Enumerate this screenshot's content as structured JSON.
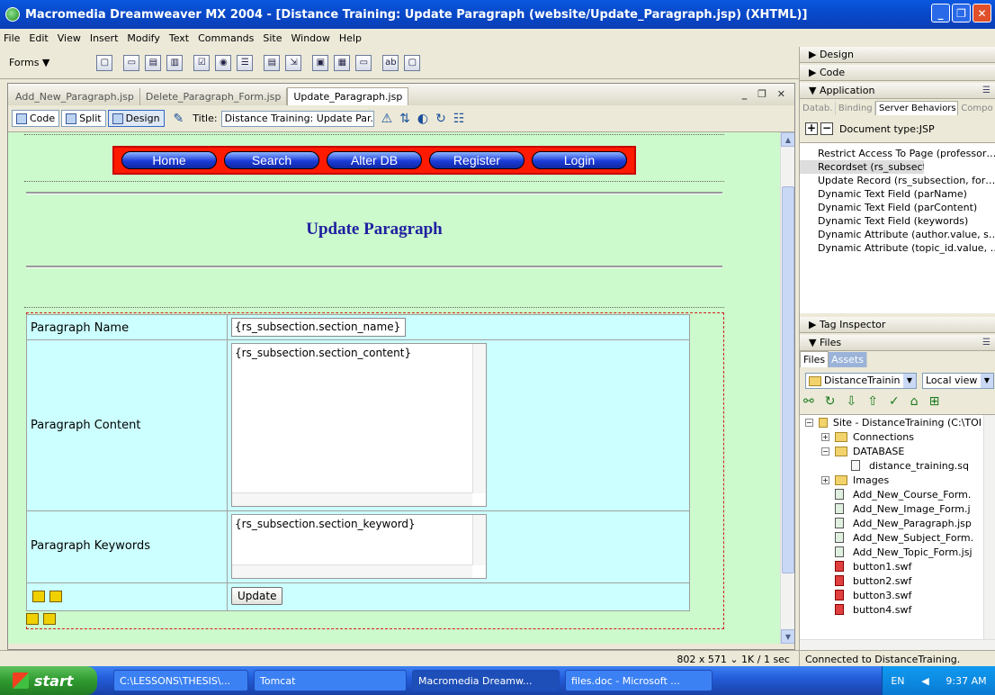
{
  "window": {
    "title": "Macromedia Dreamweaver MX 2004 - [Distance Training: Update Paragraph (website/Update_Paragraph.jsp) (XHTML)]"
  },
  "menu": [
    "File",
    "Edit",
    "View",
    "Insert",
    "Modify",
    "Text",
    "Commands",
    "Site",
    "Window",
    "Help"
  ],
  "insert_bar": {
    "category": "Forms ▼"
  },
  "doc_tabs": [
    "Add_New_Paragraph.jsp",
    "Delete_Paragraph_Form.jsp",
    "Update_Paragraph.jsp"
  ],
  "doc_toolbar": {
    "code": "Code",
    "split": "Split",
    "design": "Design",
    "title_label": "Title:",
    "title_value": "Distance Training: Update Par."
  },
  "page": {
    "nav": [
      "Home",
      "Search",
      "Alter DB",
      "Register",
      "Login"
    ],
    "heading": "Update Paragraph",
    "form": {
      "name_label": "Paragraph Name",
      "name_value": "{rs_subsection.section_name}",
      "content_label": "Paragraph Content",
      "content_value": "{rs_subsection.section_content}",
      "keywords_label": "Paragraph Keywords",
      "keywords_value": "{rs_subsection.section_keyword}",
      "submit": "Update"
    }
  },
  "status": {
    "dims": "802 x 571 ⌄ 1K / 1 sec"
  },
  "panels": {
    "design": "▶ Design",
    "code": "▶ Code",
    "application": "▼ Application",
    "app_tabs": [
      "Datab.",
      "Binding",
      "Server Behaviors",
      "Compo"
    ],
    "doc_type": "Document type:JSP",
    "server_behaviors": [
      "Restrict Access To Page (professor…",
      "Recordset (rs_subsection)",
      "Update Record (rs_subsection, for…",
      "Dynamic Text Field (parName)",
      "Dynamic Text Field (parContent)",
      "Dynamic Text Field (keywords)",
      "Dynamic Attribute (author.value, s…",
      "Dynamic Attribute (topic_id.value, …"
    ],
    "tag_inspector": "▶ Tag Inspector",
    "files": "▼ Files",
    "files_tabs": [
      "Files",
      "Assets"
    ],
    "site_select": "DistanceTrainin",
    "view_select": "Local view",
    "tree": [
      {
        "label": "Site - DistanceTraining (C:\\TOI",
        "icon": "folder",
        "level": 0,
        "exp": "−"
      },
      {
        "label": "Connections",
        "icon": "folder",
        "level": 1,
        "exp": "+"
      },
      {
        "label": "DATABASE",
        "icon": "folder",
        "level": 1,
        "exp": "−"
      },
      {
        "label": "distance_training.sq",
        "icon": "sql",
        "level": 2,
        "exp": ""
      },
      {
        "label": "Images",
        "icon": "folder",
        "level": 1,
        "exp": "+"
      },
      {
        "label": "Add_New_Course_Form.",
        "icon": "jsp",
        "level": 1,
        "exp": ""
      },
      {
        "label": "Add_New_Image_Form.j",
        "icon": "jsp",
        "level": 1,
        "exp": ""
      },
      {
        "label": "Add_New_Paragraph.jsp",
        "icon": "jsp",
        "level": 1,
        "exp": ""
      },
      {
        "label": "Add_New_Subject_Form.",
        "icon": "jsp",
        "level": 1,
        "exp": ""
      },
      {
        "label": "Add_New_Topic_Form.jsj",
        "icon": "jsp",
        "level": 1,
        "exp": ""
      },
      {
        "label": "button1.swf",
        "icon": "swf",
        "level": 1,
        "exp": ""
      },
      {
        "label": "button2.swf",
        "icon": "swf",
        "level": 1,
        "exp": ""
      },
      {
        "label": "button3.swf",
        "icon": "swf",
        "level": 1,
        "exp": ""
      },
      {
        "label": "button4.swf",
        "icon": "swf",
        "level": 1,
        "exp": ""
      }
    ],
    "connected": "Connected to DistanceTraining."
  },
  "taskbar": {
    "start": "start",
    "tasks": [
      "C:\\LESSONS\\THESIS\\...",
      "Tomcat",
      "Macromedia Dreamw...",
      "files.doc - Microsoft ..."
    ],
    "lang": "EN",
    "time": "9:37 AM"
  }
}
